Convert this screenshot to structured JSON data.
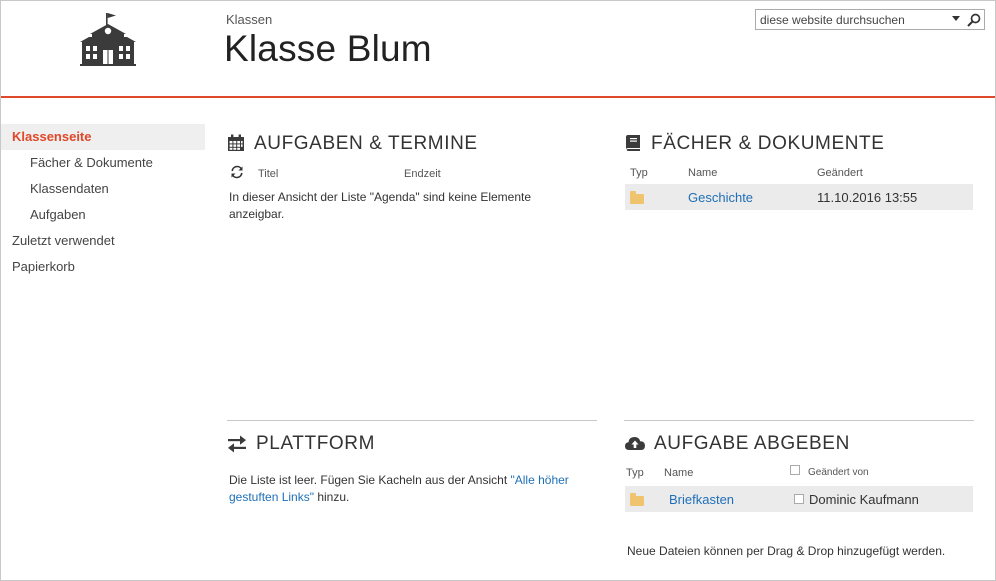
{
  "header": {
    "breadcrumb": "Klassen",
    "title": "Klasse Blum",
    "search_placeholder": "diese website durchsuchen",
    "logo_icon": "school-building-icon",
    "accent_color": "#e0482a"
  },
  "nav": {
    "items": [
      {
        "label": "Klassenseite",
        "selected": true
      },
      {
        "label": "Fächer & Dokumente"
      },
      {
        "label": "Klassendaten"
      },
      {
        "label": "Aufgaben"
      },
      {
        "label": "Zuletzt verwendet"
      },
      {
        "label": "Papierkorb"
      }
    ]
  },
  "tasks": {
    "title": "AUFGABEN & TERMINE",
    "icon": "calendar-icon",
    "col_title": "Titel",
    "col_end": "Endzeit",
    "empty_message": "In dieser Ansicht der Liste \"Agenda\" sind keine Elemente anzeigbar."
  },
  "subjects": {
    "title": "FÄCHER & DOKUMENTE",
    "icon": "book-icon",
    "col_type": "Typ",
    "col_name": "Name",
    "col_modified": "Geändert",
    "rows": [
      {
        "name": "Geschichte",
        "modified": "11.10.2016 13:55"
      }
    ]
  },
  "platform": {
    "title": "PLATTFORM",
    "icon": "exchange-arrows-icon",
    "text_before": "Die Liste ist leer. Fügen Sie Kacheln aus der Ansicht ",
    "link_text": "\"Alle höher gestuften Links\"",
    "text_after": " hinzu."
  },
  "submit": {
    "title": "AUFGABE ABGEBEN",
    "icon": "cloud-upload-icon",
    "col_type": "Typ",
    "col_name": "Name",
    "col_modified_by": "Geändert von",
    "rows": [
      {
        "name": "Briefkasten",
        "modified_by": "Dominic Kaufmann"
      }
    ],
    "footer": "Neue Dateien können per Drag & Drop hinzugefügt werden."
  }
}
